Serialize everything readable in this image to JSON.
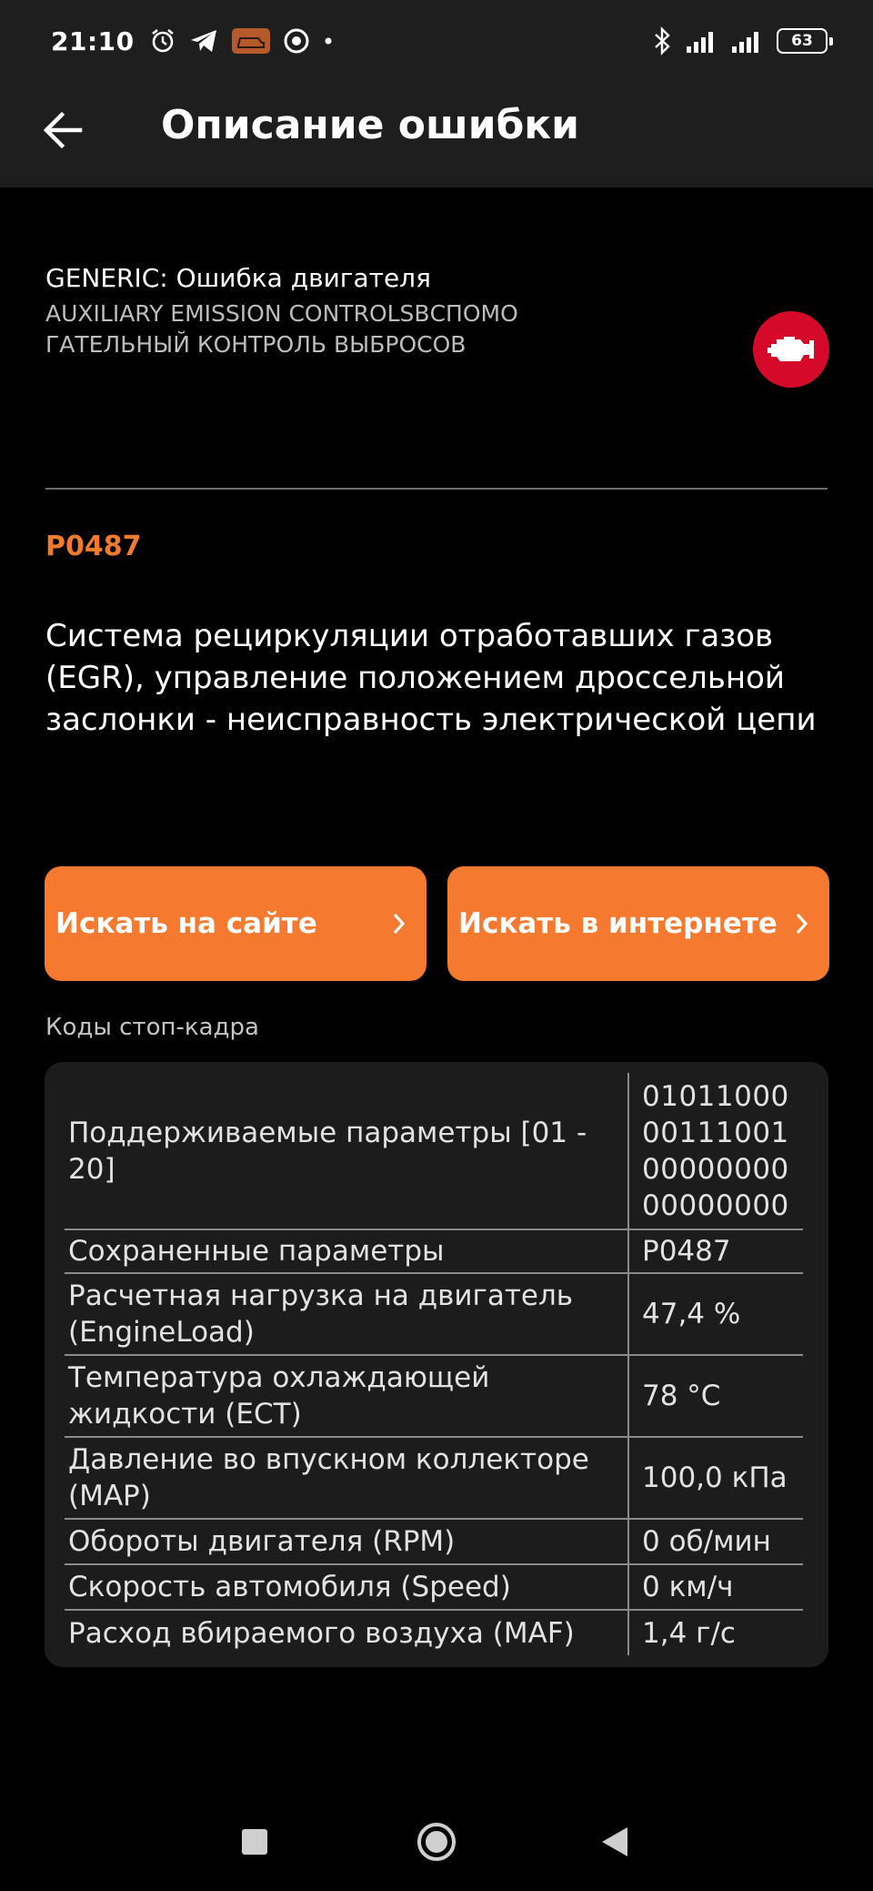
{
  "status_bar": {
    "time": "21:10",
    "battery": "63",
    "icons": [
      "alarm-icon",
      "telegram-icon",
      "car-app-icon",
      "chrome-icon",
      "dot-icon",
      "bluetooth-icon",
      "signal-icon",
      "signal-icon",
      "battery-icon"
    ]
  },
  "appbar": {
    "title": "Описание ошибки"
  },
  "error": {
    "category": "GENERIC: Ошибка двигателя",
    "subtitle": "AUXILIARY EMISSION CONTROLSВСПОМОГАТЕЛЬНЫЙ КОНТРОЛЬ ВЫБРОСОВ",
    "code": "P0487",
    "description": "Система рециркуляции отработавших газов (EGR), управление положением дроссельной заслонки - неисправность электрической цепи"
  },
  "actions": {
    "search_site": "Искать на сайте",
    "search_internet": "Искать в интернете"
  },
  "freeze_frame": {
    "title": "Коды стоп-кадра",
    "rows": [
      {
        "name": "Поддерживаемые параметры [01 - 20]",
        "value": "01011000001110010000000000000000"
      },
      {
        "name": "Сохраненные параметры",
        "value": "P0487"
      },
      {
        "name": "Расчетная нагрузка на двигатель (EngineLoad)",
        "value": "47,4 %"
      },
      {
        "name": "Температура охлаждающей жидкости (ECT)",
        "value": "78 °C"
      },
      {
        "name": "Давление во впускном коллекторе (MAP)",
        "value": "100,0 кПа"
      },
      {
        "name": "Обороты двигателя (RPM)",
        "value": "0 об/мин"
      },
      {
        "name": "Скорость автомобиля (Speed)",
        "value": "0 км/ч"
      },
      {
        "name": "Расход вбираемого воздуха (MAF)",
        "value": "1,4 г/с"
      }
    ]
  },
  "colors": {
    "accent": "#f5792e",
    "code": "#f07a2e",
    "engine_badge": "#d50a2a",
    "card": "#1c1c1c"
  }
}
